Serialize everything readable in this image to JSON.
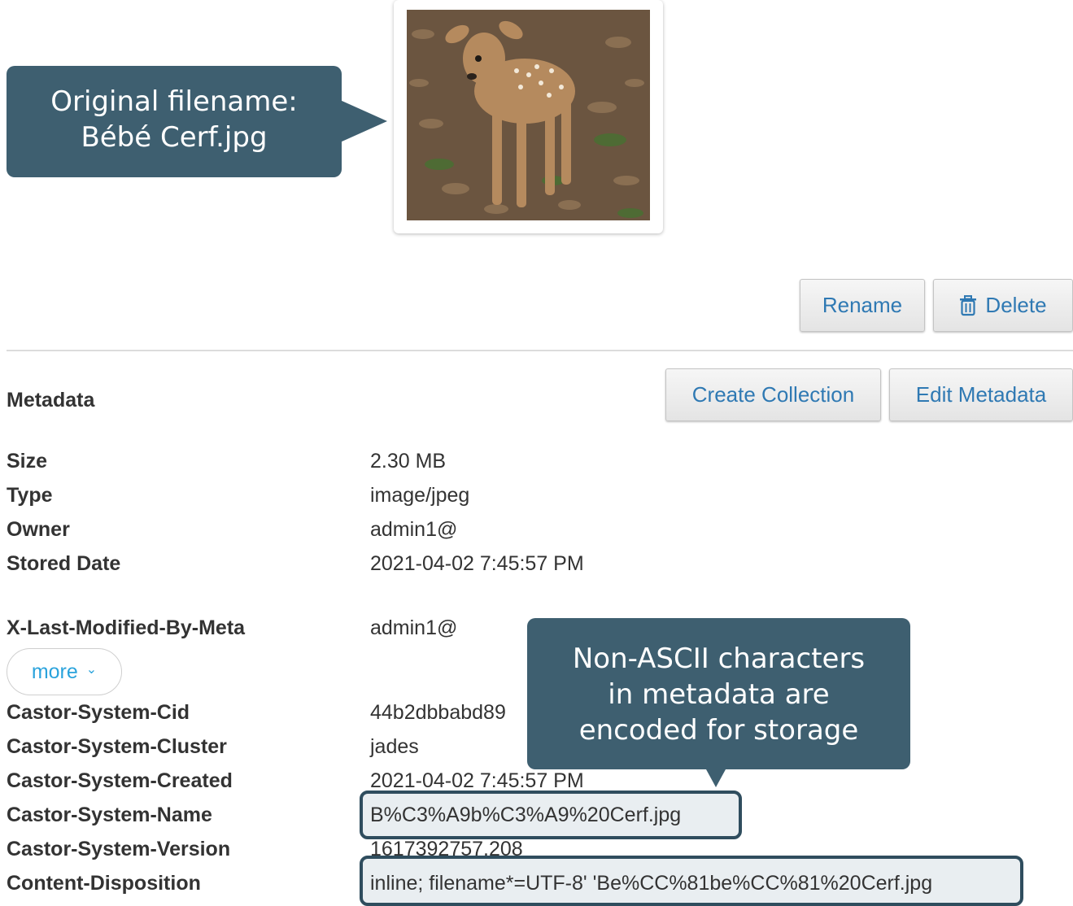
{
  "callouts": {
    "filename_note": [
      "Original filename:",
      "Bébé Cerf.jpg"
    ],
    "encoding_note": [
      "Non-ASCII characters",
      "in metadata are",
      "encoded for storage"
    ]
  },
  "thumbnail": {
    "alt": "fawn photo"
  },
  "actions": {
    "rename": "Rename",
    "delete": "Delete",
    "create_collection": "Create Collection",
    "edit_metadata": "Edit Metadata"
  },
  "metadata": {
    "title": "Metadata",
    "basic": [
      {
        "label": "Size",
        "value": "2.30 MB"
      },
      {
        "label": "Type",
        "value": "image/jpeg"
      },
      {
        "label": "Owner",
        "value": "admin1@"
      },
      {
        "label": "Stored Date",
        "value": "2021-04-02 7:45:57 PM"
      }
    ],
    "last_modified": {
      "label": "X-Last-Modified-By-Meta",
      "value": "admin1@"
    },
    "more_label": "more",
    "system": [
      {
        "label": "Castor-System-Cid",
        "value": "44b2dbbabd89"
      },
      {
        "label": "Castor-System-Cluster",
        "value": "jades"
      },
      {
        "label": "Castor-System-Created",
        "value": "2021-04-02 7:45:57 PM"
      },
      {
        "label": "Castor-System-Name",
        "value": "B%C3%A9b%C3%A9%20Cerf.jpg"
      },
      {
        "label": "Castor-System-Version",
        "value": "1617392757.208"
      },
      {
        "label": "Content-Disposition",
        "value": "inline; filename*=UTF-8' 'Be%CC%81be%CC%81%20Cerf.jpg"
      }
    ]
  },
  "colors": {
    "callout": "#3e5f70",
    "link": "#2f79b3",
    "more": "#2aa3dc",
    "highlight_border": "#2f4d5e"
  }
}
